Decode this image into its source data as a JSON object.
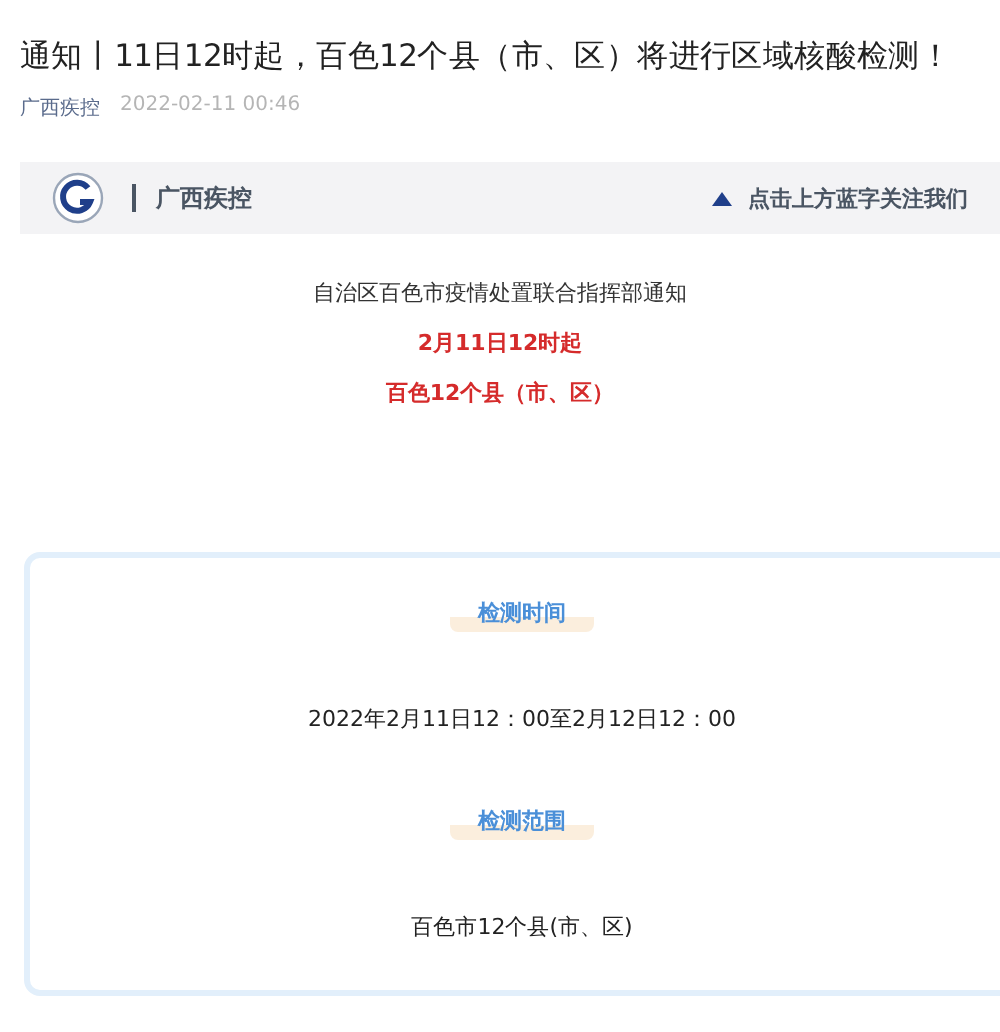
{
  "article": {
    "title": "通知丨11日12时起，百色12个县（市、区）将进行区域核酸检测！",
    "author": "广西疾控",
    "date": "2022-02-11 00:46"
  },
  "header_banner": {
    "account": "广西疾控",
    "follow_hint": "点击上方蓝字关注我们"
  },
  "notice": {
    "issuer": "自治区百色市疫情处置联合指挥部通知",
    "headlines": [
      "2月11日12时起",
      "百色12个县（市、区）"
    ]
  },
  "info_card": {
    "sections": [
      {
        "heading": "检测时间",
        "body": "2022年2月11日12：00至2月12日12：00"
      },
      {
        "heading": "检测范围",
        "body": "百色市12个县(市、区)"
      }
    ]
  }
}
